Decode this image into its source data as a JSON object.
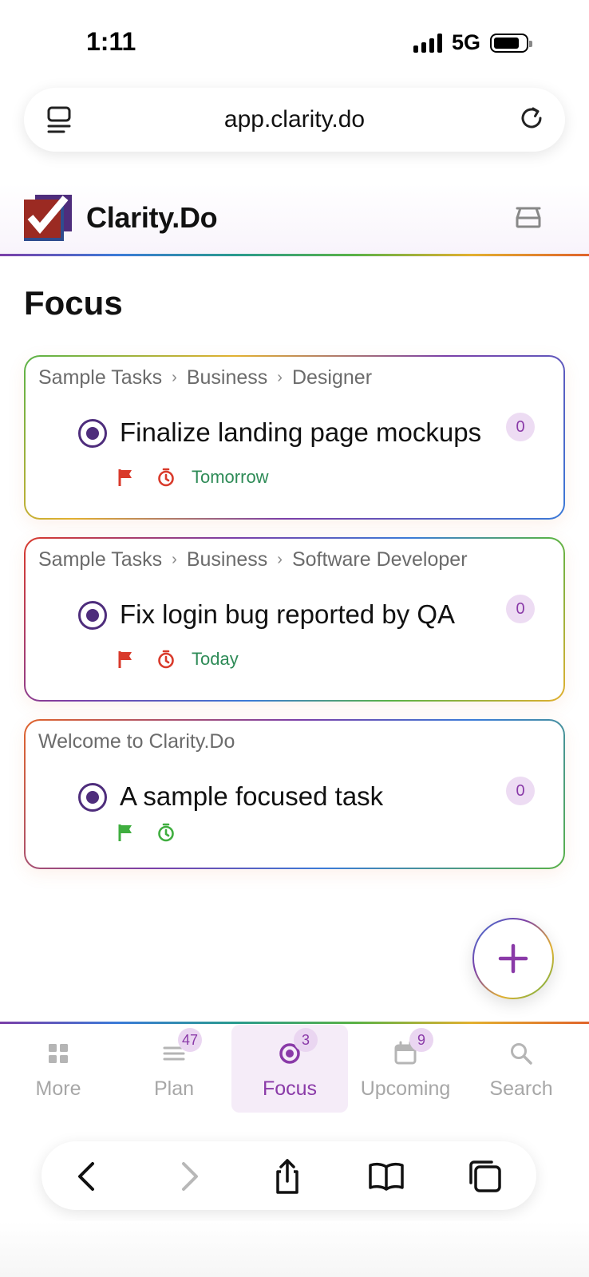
{
  "status_bar": {
    "time": "1:11",
    "network": "5G"
  },
  "browser": {
    "url": "app.clarity.do"
  },
  "app": {
    "name": "Clarity.Do"
  },
  "page": {
    "title": "Focus"
  },
  "tasks": [
    {
      "breadcrumb": [
        "Sample Tasks",
        "Business",
        "Designer"
      ],
      "title": "Finalize landing page mockups",
      "count": "0",
      "due": "Tomorrow",
      "icon_color": "#d93a2b"
    },
    {
      "breadcrumb": [
        "Sample Tasks",
        "Business",
        "Software Developer"
      ],
      "title": "Fix login bug reported by QA",
      "count": "0",
      "due": "Today",
      "icon_color": "#d93a2b"
    },
    {
      "breadcrumb": [
        "Welcome to Clarity.Do"
      ],
      "title": "A sample focused task",
      "count": "0",
      "due": "",
      "icon_color": "#3fae3f"
    }
  ],
  "bottom_nav": [
    {
      "label": "More",
      "icon": "grid-icon",
      "badge": ""
    },
    {
      "label": "Plan",
      "icon": "list-icon",
      "badge": "47"
    },
    {
      "label": "Focus",
      "icon": "target-icon",
      "badge": "3",
      "active": true
    },
    {
      "label": "Upcoming",
      "icon": "calendar-icon",
      "badge": "9"
    },
    {
      "label": "Search",
      "icon": "search-icon",
      "badge": ""
    }
  ],
  "colors": {
    "accent": "#8a3aa8",
    "check": "#4e2d7c",
    "due": "#2e8b57",
    "flag_red": "#d93a2b",
    "flag_green": "#3fae3f"
  }
}
